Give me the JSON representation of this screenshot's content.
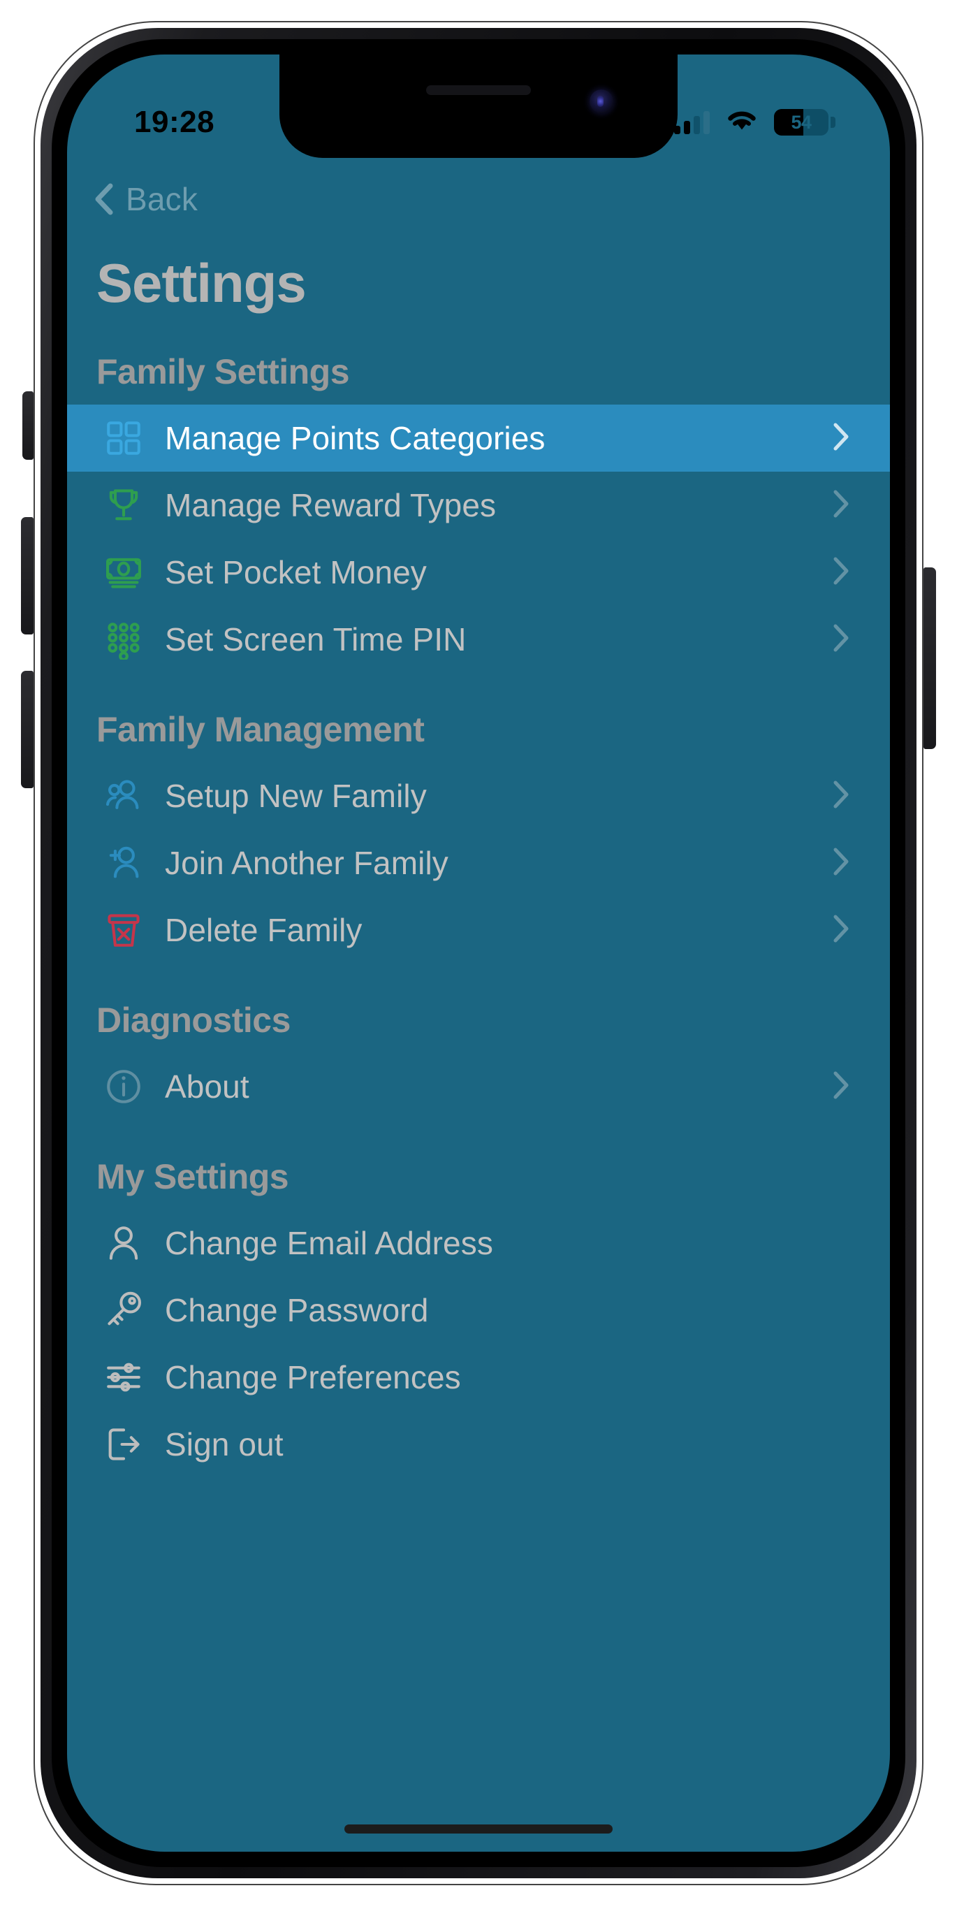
{
  "statusbar": {
    "time": "19:28",
    "signal_icon": "cellular-signal-icon",
    "wifi_icon": "wifi-icon",
    "battery_percent": "54",
    "battery_level": 54
  },
  "nav": {
    "back_label": "Back",
    "back_icon": "chevron-left-icon"
  },
  "header": {
    "title": "Settings"
  },
  "colors": {
    "screen_bg": "#1b6682",
    "selected_row_bg": "#2b8cbe",
    "section_header": "#9a9a9a",
    "label": "#c2c2c2",
    "label_selected": "#ffffff",
    "green_icon": "#2e9e4f",
    "blue_icon": "#2b8cbe",
    "light_blue_icon": "#3aa8e0",
    "red_icon": "#c6354a",
    "grey_icon": "#bdbdbd",
    "muted_icon": "#5f8fa2"
  },
  "sections": [
    {
      "title": "Family Settings",
      "items": [
        {
          "label": "Manage Points Categories",
          "icon": "grid-squares-icon",
          "icon_color": "#3aa8e0",
          "selected": true,
          "chevron": true
        },
        {
          "label": "Manage Reward Types",
          "icon": "trophy-icon",
          "icon_color": "#2e9e4f",
          "selected": false,
          "chevron": true
        },
        {
          "label": "Set Pocket Money",
          "icon": "banknote-icon",
          "icon_color": "#2e9e4f",
          "selected": false,
          "chevron": true
        },
        {
          "label": "Set Screen Time PIN",
          "icon": "keypad-icon",
          "icon_color": "#2e9e4f",
          "selected": false,
          "chevron": true
        }
      ]
    },
    {
      "title": "Family Management",
      "items": [
        {
          "label": "Setup New Family",
          "icon": "people-icon",
          "icon_color": "#2b8cbe",
          "selected": false,
          "chevron": true
        },
        {
          "label": "Join Another Family",
          "icon": "person-add-icon",
          "icon_color": "#2b8cbe",
          "selected": false,
          "chevron": true
        },
        {
          "label": "Delete Family",
          "icon": "trash-x-icon",
          "icon_color": "#c6354a",
          "selected": false,
          "chevron": true
        }
      ]
    },
    {
      "title": "Diagnostics",
      "items": [
        {
          "label": "About",
          "icon": "info-circle-icon",
          "icon_color": "#5f8fa2",
          "selected": false,
          "chevron": true
        }
      ]
    },
    {
      "title": "My Settings",
      "items": [
        {
          "label": "Change Email Address",
          "icon": "person-icon",
          "icon_color": "#bdbdbd",
          "selected": false,
          "chevron": false
        },
        {
          "label": "Change Password",
          "icon": "key-icon",
          "icon_color": "#bdbdbd",
          "selected": false,
          "chevron": false
        },
        {
          "label": "Change Preferences",
          "icon": "sliders-icon",
          "icon_color": "#bdbdbd",
          "selected": false,
          "chevron": false
        },
        {
          "label": "Sign out",
          "icon": "sign-out-icon",
          "icon_color": "#bdbdbd",
          "selected": false,
          "chevron": false
        }
      ]
    }
  ]
}
